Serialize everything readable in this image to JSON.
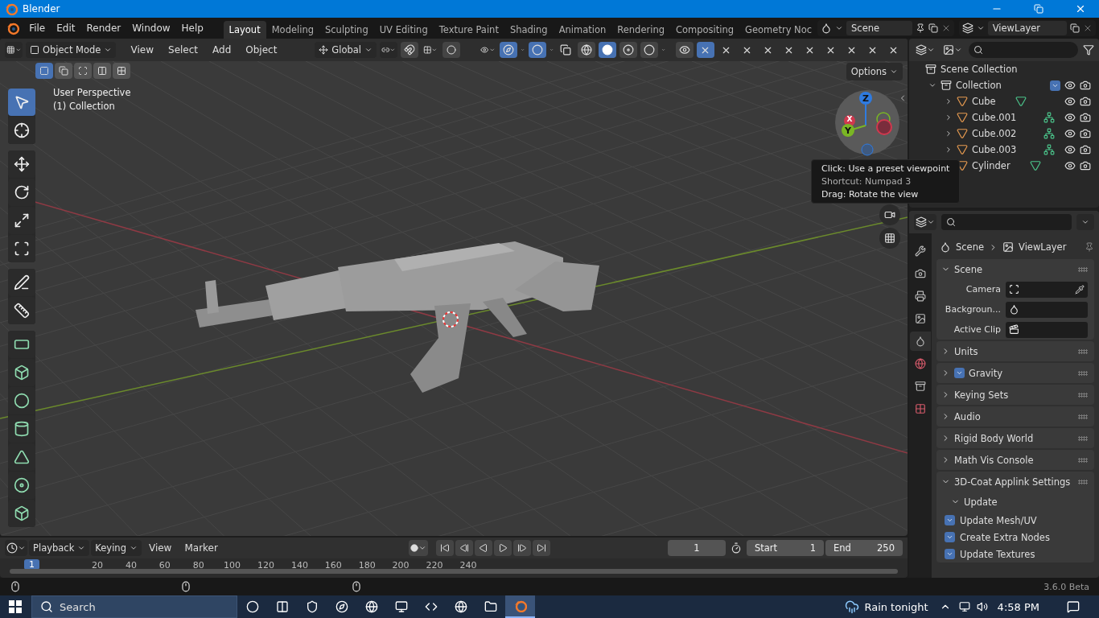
{
  "window": {
    "title": "Blender"
  },
  "menu": [
    "File",
    "Edit",
    "Render",
    "Window",
    "Help"
  ],
  "workspaces": [
    {
      "label": "Layout",
      "selected": true
    },
    {
      "label": "Modeling",
      "selected": false
    },
    {
      "label": "Sculpting",
      "selected": false
    },
    {
      "label": "UV Editing",
      "selected": false
    },
    {
      "label": "Texture Paint",
      "selected": false
    },
    {
      "label": "Shading",
      "selected": false
    },
    {
      "label": "Animation",
      "selected": false
    },
    {
      "label": "Rendering",
      "selected": false
    },
    {
      "label": "Compositing",
      "selected": false
    },
    {
      "label": "Geometry Noc",
      "selected": false
    }
  ],
  "scene": {
    "name": "Scene"
  },
  "view_layer": {
    "name": "ViewLayer"
  },
  "viewport_header": {
    "mode": "Object Mode",
    "menus": [
      "View",
      "Select",
      "Add",
      "Object"
    ],
    "orientation": "Global",
    "selection_modes": [
      {
        "kind": "set",
        "selected": true
      },
      {
        "kind": "extend",
        "selected": false
      },
      {
        "kind": "subtract",
        "selected": false
      },
      {
        "kind": "invert",
        "selected": false
      },
      {
        "kind": "intersect",
        "selected": false
      }
    ],
    "shading_modes": [
      {
        "kind": "wireframe",
        "selected": false
      },
      {
        "kind": "solid",
        "selected": true
      },
      {
        "kind": "material",
        "selected": false
      },
      {
        "kind": "rendered",
        "selected": false
      }
    ]
  },
  "viewport": {
    "info": [
      "User Perspective",
      "(1) Collection"
    ],
    "options": "Options",
    "axes": [
      {
        "label": "Z",
        "color": "#2f7be0"
      },
      {
        "label": "X",
        "color": "#d0384e"
      },
      {
        "label": "Y",
        "color": "#7ab624"
      }
    ],
    "tooltip": [
      "Click: Use a preset viewpoint",
      "Shortcut: Numpad 3",
      "Drag: Rotate the view"
    ]
  },
  "tool_groups": [
    {
      "tools": [
        {
          "kind": "select",
          "selected": true
        },
        {
          "kind": "cursor",
          "selected": false
        }
      ]
    },
    {
      "tools": [
        {
          "kind": "move",
          "selected": false
        },
        {
          "kind": "rotate",
          "selected": false
        },
        {
          "kind": "scale",
          "selected": false
        },
        {
          "kind": "transform",
          "selected": false
        }
      ]
    },
    {
      "tools": [
        {
          "kind": "annotate",
          "selected": false
        },
        {
          "kind": "measure",
          "selected": false
        }
      ]
    },
    {
      "tools": [
        {
          "kind": "add_plane",
          "selected": false
        },
        {
          "kind": "add_cube",
          "selected": false
        },
        {
          "kind": "add_sphere",
          "selected": false
        },
        {
          "kind": "add_cylinder",
          "selected": false
        },
        {
          "kind": "add_cone",
          "selected": false
        },
        {
          "kind": "add_torus",
          "selected": false
        },
        {
          "kind": "add_wedge",
          "selected": false
        }
      ]
    }
  ],
  "outliner": {
    "root": "Scene Collection",
    "collections": [
      {
        "name": "Collection",
        "expanded": true,
        "checked": true,
        "children": [
          {
            "name": "Cube",
            "kind": "mesh",
            "expanded": false
          },
          {
            "name": "Cube.001",
            "kind": "edges",
            "expanded": false
          },
          {
            "name": "Cube.002",
            "kind": "edges",
            "expanded": false
          },
          {
            "name": "Cube.003",
            "kind": "edges",
            "expanded": false
          },
          {
            "name": "Cylinder",
            "kind": "mesh",
            "expanded": false
          }
        ]
      }
    ]
  },
  "properties": {
    "breadcrumb": [
      "Scene",
      "ViewLayer"
    ],
    "tabs": [
      {
        "kind": "tool",
        "selected": false
      },
      {
        "kind": "render",
        "selected": false
      },
      {
        "kind": "output",
        "selected": false
      },
      {
        "kind": "view_layer",
        "selected": false
      },
      {
        "kind": "scene",
        "selected": true
      },
      {
        "kind": "world",
        "selected": false
      },
      {
        "kind": "collection",
        "selected": false
      },
      {
        "kind": "texture",
        "selected": false
      }
    ],
    "panels": [
      {
        "title": "Scene",
        "expanded": true,
        "fields": [
          {
            "label": "Camera",
            "kind": "camera"
          },
          {
            "label": "Backgroun...",
            "kind": "scene"
          },
          {
            "label": "Active Clip",
            "kind": "clip"
          }
        ]
      },
      {
        "title": "Units",
        "expanded": false
      },
      {
        "title": "Gravity",
        "expanded": false,
        "checked": true
      },
      {
        "title": "Keying Sets",
        "expanded": false
      },
      {
        "title": "Audio",
        "expanded": false
      },
      {
        "title": "Rigid Body World",
        "expanded": false
      },
      {
        "title": "Math Vis Console",
        "expanded": false
      },
      {
        "title": "3D-Coat Applink Settings",
        "expanded": true,
        "subpanels": [
          {
            "title": "Update",
            "expanded": true,
            "options": [
              {
                "label": "Update Mesh/UV",
                "checked": true
              },
              {
                "label": "Create Extra Nodes",
                "checked": true
              },
              {
                "label": "Update Textures",
                "checked": true
              }
            ]
          }
        ]
      }
    ]
  },
  "timeline": {
    "menus": [
      "Playback",
      "Keying",
      "View",
      "Marker"
    ],
    "current_frame": "1",
    "start_label": "Start",
    "start": "1",
    "end_label": "End",
    "end": "250",
    "playhead": "1",
    "ruler": [
      "20",
      "40",
      "60",
      "80",
      "100",
      "120",
      "140",
      "160",
      "180",
      "200",
      "220",
      "240"
    ]
  },
  "status_bar": {
    "version": "3.6.0 Beta"
  },
  "taskbar": {
    "search": {
      "placeholder": "Search"
    },
    "apps": [
      {
        "kind": "cortana",
        "selected": false
      },
      {
        "kind": "task_view",
        "selected": false
      },
      {
        "kind": "security",
        "selected": false
      },
      {
        "kind": "edge",
        "selected": false
      },
      {
        "kind": "chrome",
        "selected": false
      },
      {
        "kind": "remote",
        "selected": false
      },
      {
        "kind": "code",
        "selected": false
      },
      {
        "kind": "chrome",
        "selected": false
      },
      {
        "kind": "folder",
        "selected": false
      },
      {
        "kind": "blender",
        "selected": true
      }
    ],
    "weather": "Rain tonight",
    "time": "4:58 PM"
  }
}
